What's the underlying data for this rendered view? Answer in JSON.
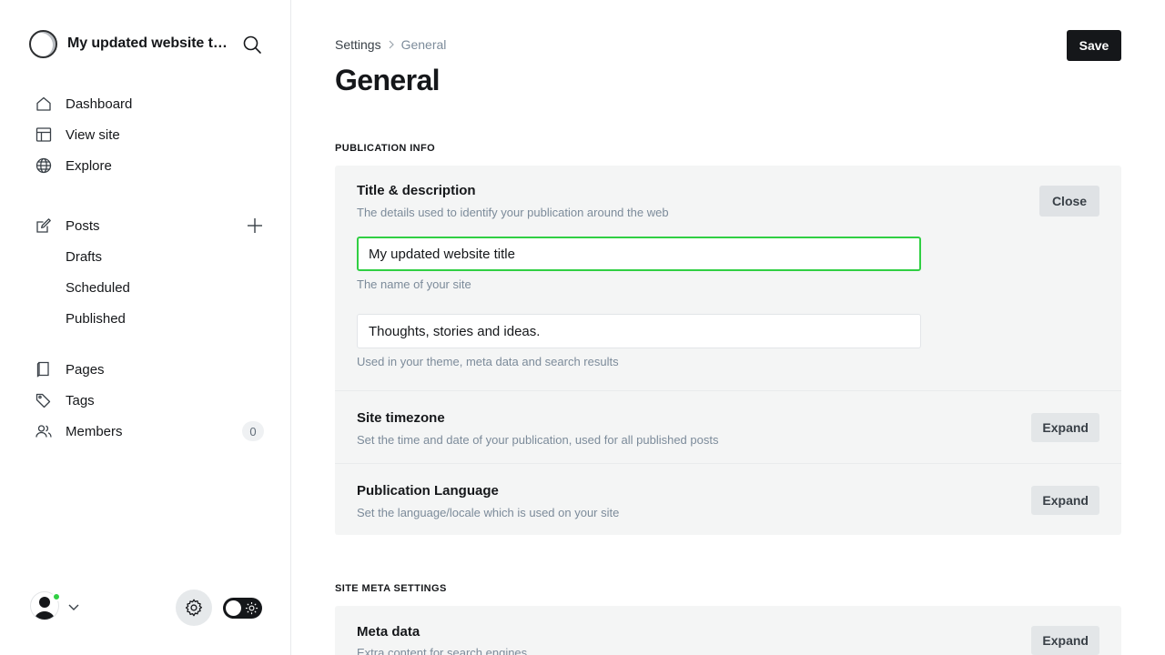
{
  "app": {
    "site_title": "My updated website title",
    "accent_color": "#30cf43"
  },
  "sidebar": {
    "search_icon": "search-icon",
    "items": [
      {
        "label": "Dashboard",
        "icon": "home-icon"
      },
      {
        "label": "View site",
        "icon": "layout-icon"
      },
      {
        "label": "Explore",
        "icon": "globe-icon"
      },
      {
        "label": "Posts",
        "icon": "edit-icon"
      },
      {
        "label": "Drafts"
      },
      {
        "label": "Scheduled"
      },
      {
        "label": "Published"
      },
      {
        "label": "Pages",
        "icon": "page-icon"
      },
      {
        "label": "Tags",
        "icon": "tag-icon"
      },
      {
        "label": "Members",
        "icon": "members-icon",
        "count": "0"
      }
    ]
  },
  "main": {
    "breadcrumb": {
      "root": "Settings",
      "current": "General"
    },
    "save_label": "Save",
    "page_title": "General",
    "sections": {
      "publication_info": "PUBLICATION INFO",
      "site_meta": "SITE META SETTINGS"
    },
    "title_desc": {
      "title": "Title & description",
      "desc": "The details used to identify your publication around the web",
      "close_label": "Close",
      "site_title_value": "My updated website title",
      "site_title_hint": "The name of your site",
      "site_desc_value": "Thoughts, stories and ideas.",
      "site_desc_hint": "Used in your theme, meta data and search results"
    },
    "timezone": {
      "title": "Site timezone",
      "desc": "Set the time and date of your publication, used for all published posts",
      "expand_label": "Expand"
    },
    "language": {
      "title": "Publication Language",
      "desc": "Set the language/locale which is used on your site",
      "expand_label": "Expand"
    },
    "meta": {
      "title": "Meta data",
      "desc": "Extra content for search engines",
      "expand_label": "Expand"
    }
  }
}
